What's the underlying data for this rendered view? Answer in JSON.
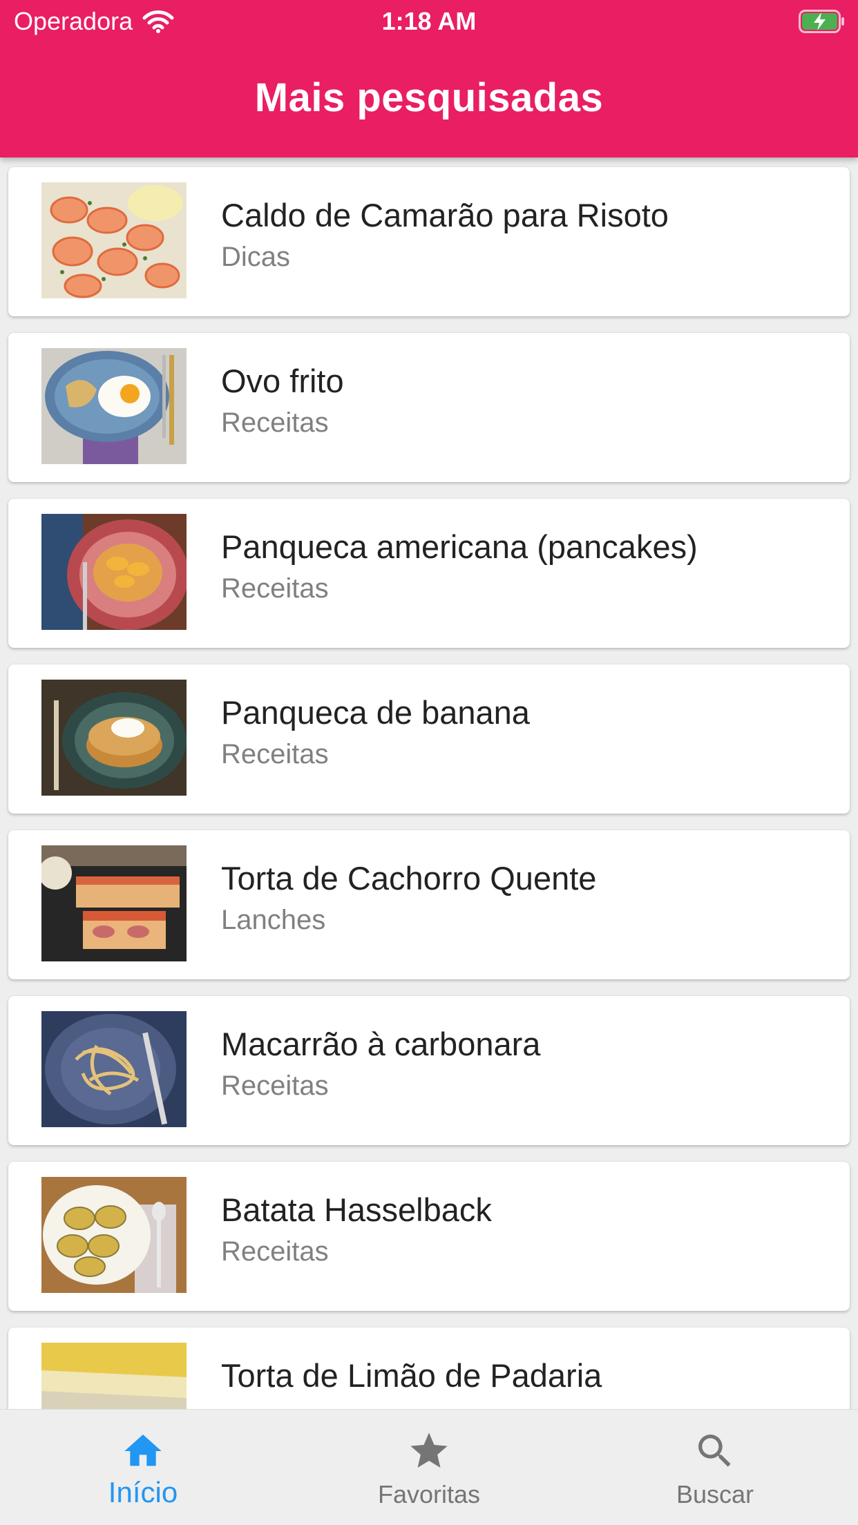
{
  "status_bar": {
    "carrier": "Operadora",
    "time": "1:18 AM",
    "battery_color": "#4caf50"
  },
  "app_bar": {
    "title": "Mais pesquisadas",
    "color": "#e91e63"
  },
  "recipes": [
    {
      "title": "Caldo de Camarão para Risoto",
      "category": "Dicas",
      "image": "shrimp"
    },
    {
      "title": "Ovo frito",
      "category": "Receitas",
      "image": "fried-egg"
    },
    {
      "title": "Panqueca americana (pancakes)",
      "category": "Receitas",
      "image": "pancakes"
    },
    {
      "title": "Panqueca de banana",
      "category": "Receitas",
      "image": "banana-pancake"
    },
    {
      "title": "Torta de Cachorro Quente",
      "category": "Lanches",
      "image": "hotdog-pie"
    },
    {
      "title": "Macarrão à carbonara",
      "category": "Receitas",
      "image": "carbonara"
    },
    {
      "title": "Batata Hasselback",
      "category": "Receitas",
      "image": "hasselback-potato"
    },
    {
      "title": "Torta de Limão de Padaria",
      "category": "",
      "image": "lemon-pie"
    }
  ],
  "bottom_nav": {
    "items": [
      {
        "label": "Início",
        "icon": "home-icon",
        "active": true
      },
      {
        "label": "Favoritas",
        "icon": "star-icon",
        "active": false
      },
      {
        "label": "Buscar",
        "icon": "search-icon",
        "active": false
      }
    ],
    "active_color": "#2196f3",
    "inactive_color": "#757575"
  }
}
